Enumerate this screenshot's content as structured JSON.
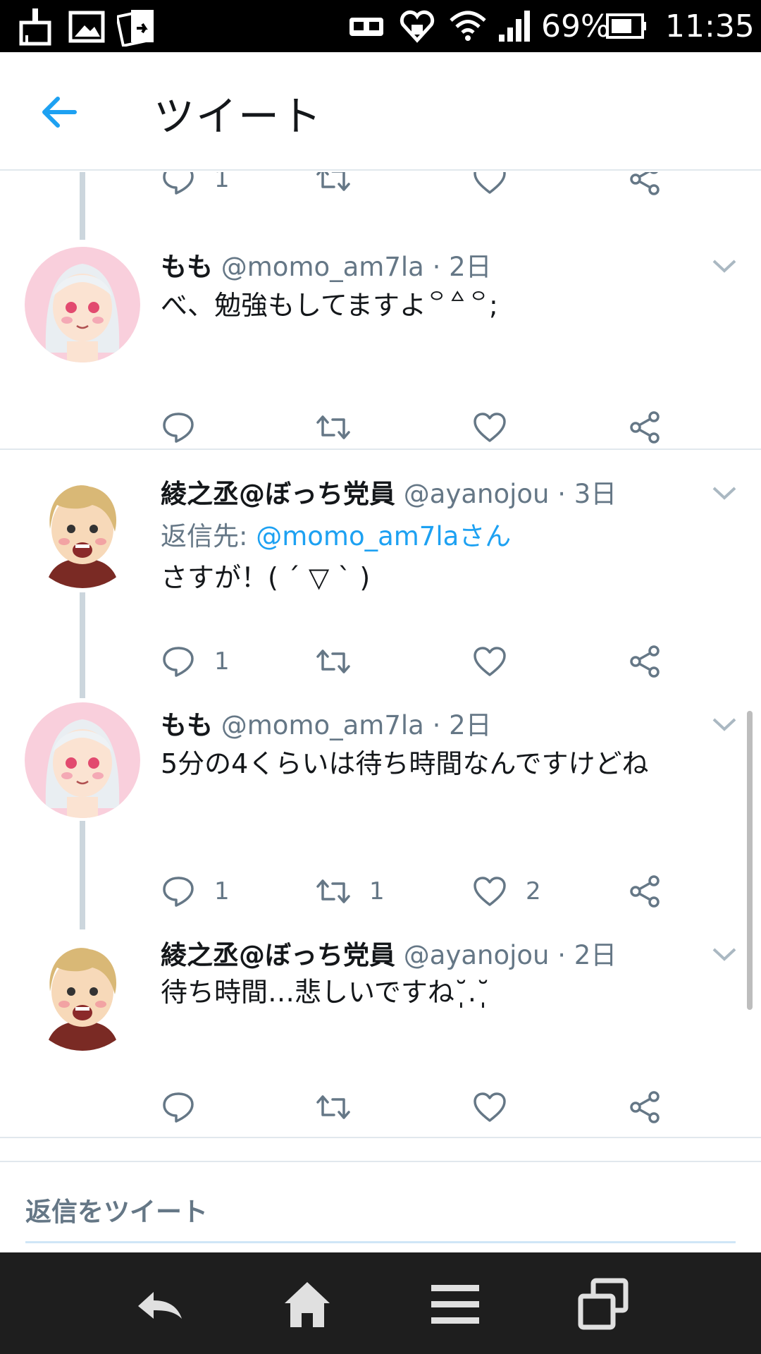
{
  "status_bar": {
    "battery": "69%",
    "time": "11:35",
    "icons": [
      "cleaner-icon",
      "gallery-icon",
      "screen-share-icon",
      "vr-icon",
      "heart-shield-icon",
      "wifi-icon",
      "signal-icon",
      "battery-icon"
    ]
  },
  "header": {
    "title": "ツイート",
    "back_icon": "arrow-left-icon"
  },
  "tweets": [
    {
      "name": "もも",
      "handle": "@momo_am7la",
      "dot": "·",
      "time": "2日",
      "body": "べ、勉強もしてますよ꒪꒫꒪;",
      "reply_count": "",
      "retweet_count": "",
      "like_count": ""
    },
    {
      "name": "綾之丞@ぼっち党員",
      "handle": "@ayanojou",
      "dot": "·",
      "time": "3日",
      "reply_to_label": "返信先:",
      "reply_to_mention": "@momo_am7laさん",
      "body": "さすが！( ´ ▽ ` )",
      "reply_count": "1",
      "retweet_count": "",
      "like_count": ""
    },
    {
      "name": "もも",
      "handle": "@momo_am7la",
      "dot": "·",
      "time": "2日",
      "body": "5分の4くらいは待ち時間なんですけどね",
      "reply_count": "1",
      "retweet_count": "1",
      "like_count": "2"
    },
    {
      "name": "綾之丞@ぼっち党員",
      "handle": "@ayanojou",
      "dot": "·",
      "time": "2日",
      "body": "待ち時間…悲しいですね˘̩̩̩.˘̩̩̩",
      "reply_count": "",
      "retweet_count": "",
      "like_count": ""
    }
  ],
  "partial_top_tweet": {
    "reply_count": "1"
  },
  "reply_box": {
    "placeholder": "返信をツイート"
  },
  "colors": {
    "accent": "#1da1f2",
    "text": "#14171a",
    "secondary": "#657786",
    "divider": "#e1e8ed",
    "thread_line": "#ccd6dd",
    "navbar": "#1e1e1e"
  }
}
